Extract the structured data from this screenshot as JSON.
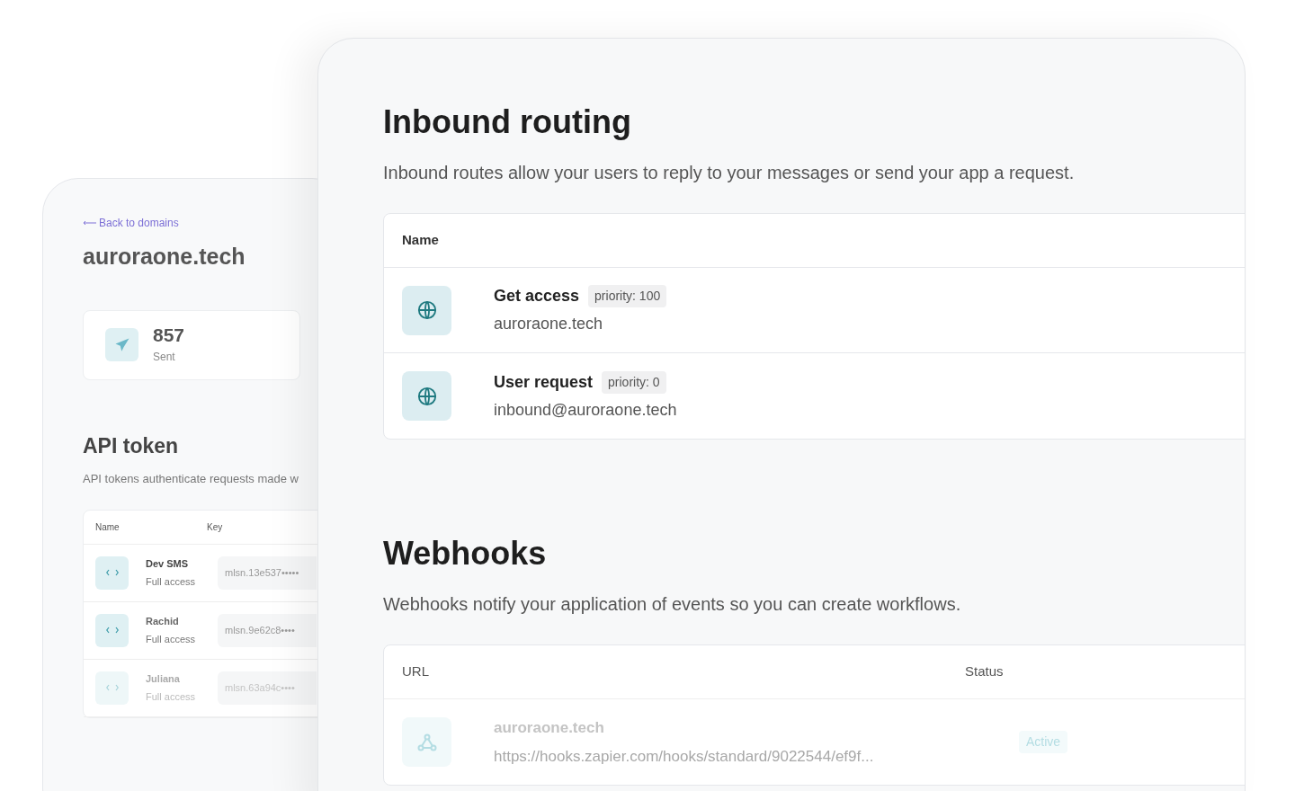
{
  "domain_page": {
    "back_link": "Back to domains",
    "title": "auroraone.tech",
    "stat": {
      "value": "857",
      "label": "Sent"
    },
    "api_token": {
      "title": "API token",
      "description": "API tokens authenticate requests made w",
      "columns": [
        "Name",
        "Key"
      ],
      "rows": [
        {
          "name": "Dev SMS",
          "access": "Full access",
          "key": "mlsn.13e537•••••"
        },
        {
          "name": "Rachid",
          "access": "Full access",
          "key": "mlsn.9e62c8••••"
        },
        {
          "name": "Juliana",
          "access": "Full access",
          "key": "mlsn.63a94c••••"
        }
      ]
    }
  },
  "inbound_routing": {
    "title": "Inbound routing",
    "description": "Inbound routes allow your users to reply to your messages or send your app a request.",
    "columns": [
      "Name"
    ],
    "rows": [
      {
        "name": "Get access",
        "priority": "priority: 100",
        "target": "auroraone.tech"
      },
      {
        "name": "User request",
        "priority": "priority: 0",
        "target": "inbound@auroraone.tech"
      }
    ]
  },
  "webhooks": {
    "title": "Webhooks",
    "description": "Webhooks notify your application of events so you can create workflows.",
    "columns": [
      "URL",
      "Status"
    ],
    "rows": [
      {
        "name": "auroraone.tech",
        "url": "https://hooks.zapier.com/hooks/standard/9022544/ef9f...",
        "status": "Active"
      }
    ]
  }
}
